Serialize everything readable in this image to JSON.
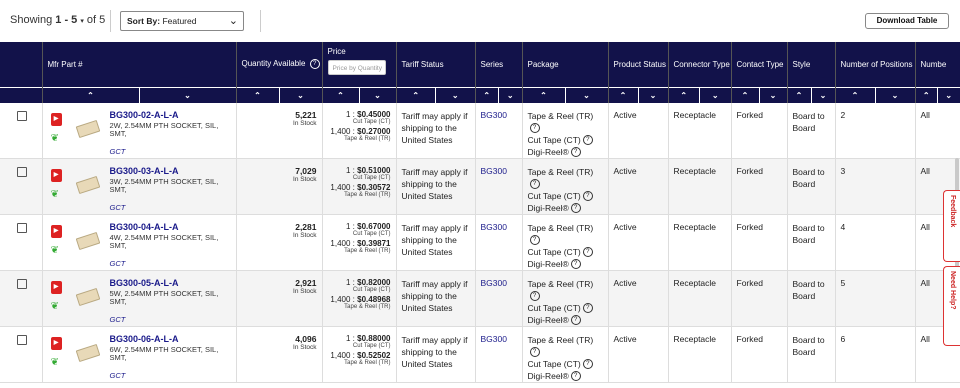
{
  "toolbar": {
    "showing_prefix": "Showing",
    "showing_range": "1 - 5",
    "showing_suffix": "of 5",
    "sort_prefix": "Sort By:",
    "sort_value": "Featured",
    "download_label": "Download Table"
  },
  "columns": [
    {
      "key": "select",
      "label": ""
    },
    {
      "key": "mfr_part",
      "label": "Mfr Part #"
    },
    {
      "key": "quantity",
      "label": "Quantity Available"
    },
    {
      "key": "price",
      "label": "Price"
    },
    {
      "key": "tariff",
      "label": "Tariff Status"
    },
    {
      "key": "series",
      "label": "Series"
    },
    {
      "key": "package",
      "label": "Package"
    },
    {
      "key": "status",
      "label": "Product Status"
    },
    {
      "key": "connector",
      "label": "Connector Type"
    },
    {
      "key": "contact",
      "label": "Contact Type"
    },
    {
      "key": "style",
      "label": "Style"
    },
    {
      "key": "positions",
      "label": "Number of Positions"
    },
    {
      "key": "number_more",
      "label": "Numbe"
    }
  ],
  "price_filter_placeholder": "Price by Quantity",
  "package_options": [
    "Tape & Reel (TR)",
    "Cut Tape (CT)",
    "Digi-Reel®"
  ],
  "rows": [
    {
      "part": "BG300-02-A-L-A",
      "desc": "2W, 2.54MM PTH SOCKET, SIL, SMT,",
      "mfr": "GCT",
      "qty": "5,221",
      "stock": "In Stock",
      "p1_qty": "1 :",
      "p1": "$0.45000",
      "p1_pkg": "Cut Tape (CT)",
      "p2_qty": "1,400 :",
      "p2": "$0.27000",
      "p2_pkg": "Tape & Reel (TR)",
      "tariff": "Tariff may apply if shipping to the United States",
      "series": "BG300",
      "status": "Active",
      "connector": "Receptacle",
      "contact": "Forked",
      "style": "Board to Board",
      "positions": "2",
      "more": "All"
    },
    {
      "part": "BG300-03-A-L-A",
      "desc": "3W, 2.54MM PTH SOCKET, SIL, SMT,",
      "mfr": "GCT",
      "qty": "7,029",
      "stock": "In Stock",
      "p1_qty": "1 :",
      "p1": "$0.51000",
      "p1_pkg": "Cut Tape (CT)",
      "p2_qty": "1,400 :",
      "p2": "$0.30572",
      "p2_pkg": "Tape & Reel (TR)",
      "tariff": "Tariff may apply if shipping to the United States",
      "series": "BG300",
      "status": "Active",
      "connector": "Receptacle",
      "contact": "Forked",
      "style": "Board to Board",
      "positions": "3",
      "more": "All"
    },
    {
      "part": "BG300-04-A-L-A",
      "desc": "4W, 2.54MM PTH SOCKET, SIL, SMT,",
      "mfr": "GCT",
      "qty": "2,281",
      "stock": "In Stock",
      "p1_qty": "1 :",
      "p1": "$0.67000",
      "p1_pkg": "Cut Tape (CT)",
      "p2_qty": "1,400 :",
      "p2": "$0.39871",
      "p2_pkg": "Tape & Reel (TR)",
      "tariff": "Tariff may apply if shipping to the United States",
      "series": "BG300",
      "status": "Active",
      "connector": "Receptacle",
      "contact": "Forked",
      "style": "Board to Board",
      "positions": "4",
      "more": "All"
    },
    {
      "part": "BG300-05-A-L-A",
      "desc": "5W, 2.54MM PTH SOCKET, SIL, SMT,",
      "mfr": "GCT",
      "qty": "2,921",
      "stock": "In Stock",
      "p1_qty": "1 :",
      "p1": "$0.82000",
      "p1_pkg": "Cut Tape (CT)",
      "p2_qty": "1,400 :",
      "p2": "$0.48968",
      "p2_pkg": "Tape & Reel (TR)",
      "tariff": "Tariff may apply if shipping to the United States",
      "series": "BG300",
      "status": "Active",
      "connector": "Receptacle",
      "contact": "Forked",
      "style": "Board to Board",
      "positions": "5",
      "more": "All"
    },
    {
      "part": "BG300-06-A-L-A",
      "desc": "6W, 2.54MM PTH SOCKET, SIL, SMT,",
      "mfr": "GCT",
      "qty": "4,096",
      "stock": "In Stock",
      "p1_qty": "1 :",
      "p1": "$0.88000",
      "p1_pkg": "Cut Tape (CT)",
      "p2_qty": "1,400 :",
      "p2": "$0.52502",
      "p2_pkg": "Tape & Reel (TR)",
      "tariff": "Tariff may apply if shipping to the United States",
      "series": "BG300",
      "status": "Active",
      "connector": "Receptacle",
      "contact": "Forked",
      "style": "Board to Board",
      "positions": "6",
      "more": "All"
    }
  ],
  "side_tabs": {
    "feedback": "Feedback",
    "help": "Need Help?"
  },
  "colors": {
    "header_bg": "#12124a",
    "link": "#1a1a8a",
    "pdf_red": "#dd2222"
  }
}
